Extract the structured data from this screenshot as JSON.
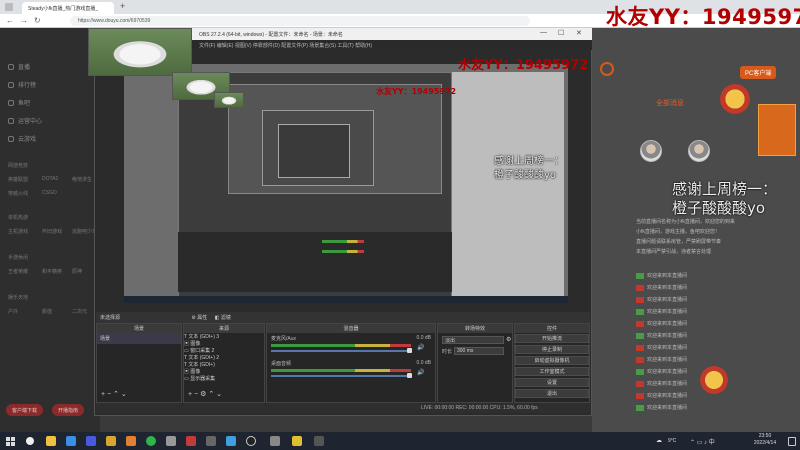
{
  "browser": {
    "tab_title": "Steady小fk直播_热门游戏直播_",
    "url": "https://www.douyu.com/6970539"
  },
  "watermark": {
    "big": "水友YY：19495972",
    "mid": "水友YY：19495972",
    "small": "水友YY：19495972"
  },
  "caption": {
    "line1": "感谢上周榜一：",
    "line2": "橙子酸酸酸yo"
  },
  "obs": {
    "title": "OBS 27.2.4 (64-bit, windows) - 配置文件：未命名 - 场景：未命名",
    "menu": "文件(F)  编辑(E)  视图(V)  停靠部件(D)  配置文件(P)  场景集合(S)  工具(T)  帮助(H)",
    "scene_label": "未选择源",
    "properties_btn": "属性",
    "filters_btn": "滤镜",
    "docks": {
      "scenes": "场景",
      "sources": "来源",
      "mixer": "混音器",
      "transitions": "转场特效",
      "controls": "控件"
    },
    "scenes": [
      "场景"
    ],
    "sources": [
      {
        "icon": "T",
        "label": "文本 (GDI+) 3"
      },
      {
        "icon": "▣",
        "label": "图像"
      },
      {
        "icon": "▭",
        "label": "窗口采集 2"
      },
      {
        "icon": "T",
        "label": "文本 (GDI+) 2"
      },
      {
        "icon": "T",
        "label": "文本 (GDI+)"
      },
      {
        "icon": "▣",
        "label": "图像"
      },
      {
        "icon": "▭",
        "label": "显示器采集"
      }
    ],
    "mixer": [
      {
        "name": "麦克风/Aux",
        "db": "0.0 dB"
      },
      {
        "name": "桌面音频",
        "db": "0.0 dB"
      }
    ],
    "transitions": {
      "type": "淡出",
      "duration_label": "时长",
      "duration": "300 ms"
    },
    "controls": [
      "开始推流",
      "停止录制",
      "启动虚拟摄像机",
      "工作室模式",
      "设置",
      "退出"
    ],
    "status": "LIVE: 00:00:00    REC: 00:00:00    CPU: 1.5%, 60.00 fps"
  },
  "leftnav": {
    "items": [
      "直播",
      "排行榜",
      "鱼吧",
      "运营中心",
      "云游戏"
    ],
    "categories": [
      "网游竞技",
      "英雄联盟",
      "DOTA2",
      "绝地求生",
      "穿越火线",
      "CSGO",
      "单机热游",
      "主机游戏",
      "怀旧游戏",
      "逃跑吧少年",
      "手游休闲",
      "王者荣耀",
      "和平精英",
      "原神",
      "娱乐天地",
      "户外",
      "颜值",
      "二次元"
    ],
    "red_btn1": "客户端下载",
    "red_btn2": "开播指南"
  },
  "chat": {
    "title": "全部消息",
    "pc_btn": "PC客户端",
    "welcome": "欢迎来到本直播间",
    "lines": [
      "当前直播间名称为小fk直播间，欢迎您的到来",
      "小fk直播间，游戏主播，鱼吧欢迎您！",
      "直播问题请联系房管，严禁刷屏带节奏",
      "本直播间严禁引战，违者禁言处理",
      "欢迎来到本直播间",
      "欢迎来到本直播间",
      "欢迎来到本直播间",
      "欢迎来到本直播间",
      "欢迎来到本直播间",
      "欢迎来到本直播间",
      "欢迎来到本直播间",
      "欢迎来到本直播间",
      "欢迎来到本直播间",
      "欢迎来到本直播间",
      "欢迎来到本直播间",
      "欢迎来到本直播间"
    ]
  },
  "taskbar": {
    "temp": "9°C",
    "time": "23:50",
    "date": "2022/4/14"
  },
  "colors": {
    "watermark": "#b00000",
    "taskbar": "#1e2530",
    "obs_bg": "#2b2b2b",
    "accent_orange": "#d85a1a"
  }
}
